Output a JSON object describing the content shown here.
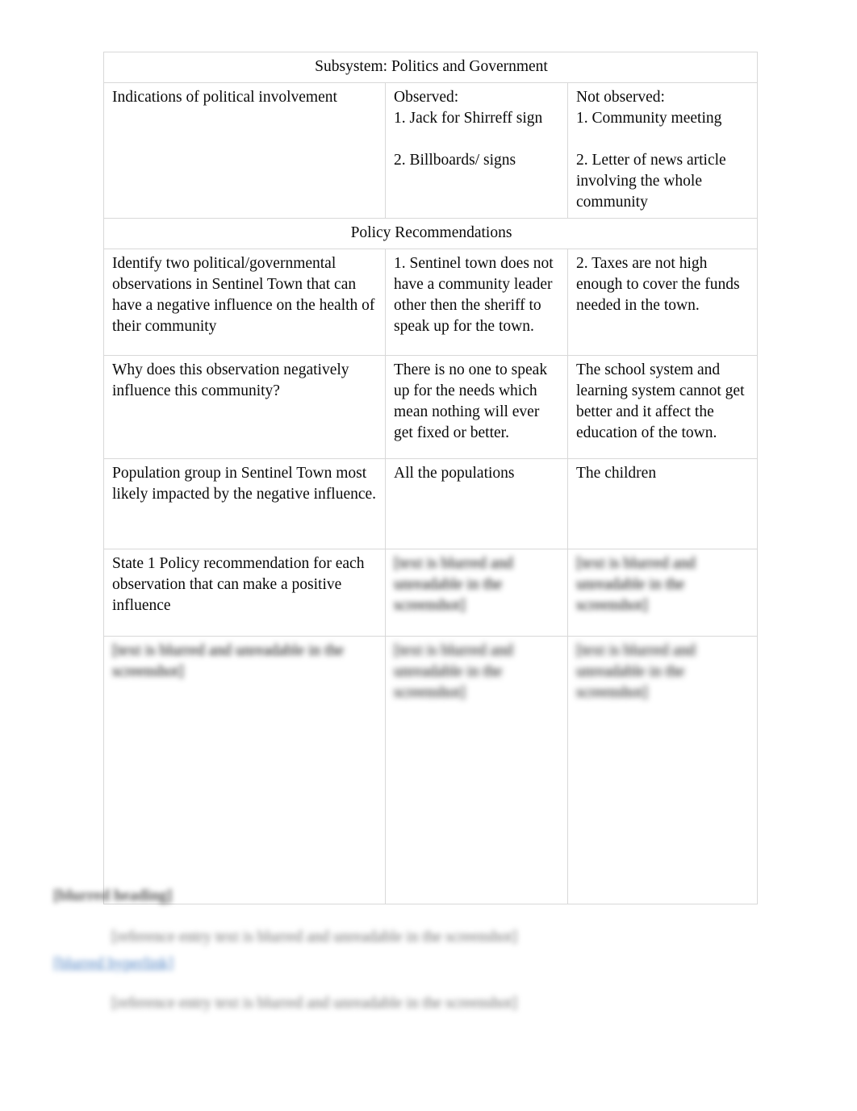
{
  "document": {
    "type": "assignment-worksheet-table"
  },
  "table": {
    "section_heading_1": "Subsystem: Politics and Government",
    "section_heading_2": "Policy Recommendations",
    "rows": [
      {
        "name": "indications-of-political-involvement",
        "prompt": "Indications of political involvement",
        "col2_lines": [
          "Observed:",
          "1. Jack for Shirreff sign",
          "",
          "2. Billboards/ signs"
        ],
        "col3_lines": [
          "Not observed:",
          "1. Community meeting",
          "",
          "2. Letter of news article involving the whole community"
        ]
      },
      {
        "name": "identify-two-observations",
        "prompt": "Identify two political/governmental observations in Sentinel Town that can have a negative influence on the health of their community",
        "col2_lines": [
          "1. Sentinel town does not have a community leader other then the sheriff to speak up for the town."
        ],
        "col3_lines": [
          "2. Taxes are not high enough to cover the funds needed in the town."
        ]
      },
      {
        "name": "why-negative-influence",
        "prompt": "Why does this observation negatively influence this community?",
        "col2_lines": [
          "There is no one to speak up for the needs which mean nothing will ever get fixed or better."
        ],
        "col3_lines": [
          "The school system and learning system cannot get better and it affect the education of the town."
        ]
      },
      {
        "name": "population-group-impacted",
        "prompt": "Population group in Sentinel Town most likely impacted by the negative influence.",
        "col2_lines": [
          "All the populations"
        ],
        "col3_lines": [
          "The children"
        ]
      },
      {
        "name": "state-one-policy-recommendation",
        "prompt": "State 1 Policy recommendation for each observation that can make a positive influence",
        "col2_lines": [
          "[text is blurred and unreadable in the screenshot]"
        ],
        "col3_lines": [
          "[text is blurred and unreadable in the screenshot]"
        ],
        "col2_blurred": true,
        "col3_blurred": true
      },
      {
        "name": "evidence-based-rationale",
        "prompt": "[text is blurred and unreadable in the screenshot]",
        "col2_lines": [
          "[text is blurred and unreadable in the screenshot]"
        ],
        "col3_lines": [
          "[text is blurred and unreadable in the screenshot]"
        ],
        "col1_blurred": true,
        "col2_blurred": true,
        "col3_blurred": true
      }
    ]
  },
  "references": {
    "heading": "[blurred heading]",
    "entry_1": "[reference entry text is blurred and unreadable in the screenshot]",
    "entry_1_link": "[blurred hyperlink]",
    "entry_2": "[reference entry text is blurred and unreadable in the screenshot]",
    "link_color": "#4a7fc1"
  }
}
